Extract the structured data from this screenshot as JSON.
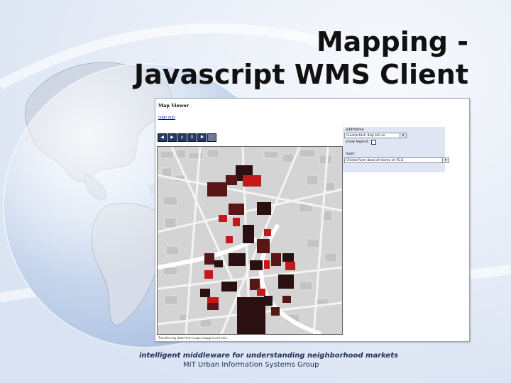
{
  "slide": {
    "title_line1": "Mapping -",
    "title_line2": "Javascript WMS Client",
    "footer_line1": "intelligent middleware for understanding neighborhood markets",
    "footer_line2": "MIT Urban Information Systems Group"
  },
  "app": {
    "title": "Map Viewer",
    "top_link": "(sign out)",
    "toolbar": {
      "buttons": [
        {
          "name": "pan-left",
          "glyph": "◀"
        },
        {
          "name": "pan-right",
          "glyph": "▶"
        },
        {
          "name": "home",
          "glyph": "⌂"
        },
        {
          "name": "zoom",
          "glyph": "⚲"
        },
        {
          "name": "settings",
          "glyph": "✱"
        },
        {
          "name": "extra",
          "glyph": "·"
        }
      ]
    },
    "panel": {
      "section1_label": "addtheme",
      "theme_select_value": "muscle fact. disp tch ce",
      "show_legend_label": "show legend:",
      "section2_label": "layer:",
      "layer_select_value": "Chilled form daea of eleme ch fG.S."
    },
    "status_text": "Transferring data from mapx.mapgrid.mit.edu..."
  },
  "colors": {
    "slide_bg": "#e9eff9",
    "panel_bg": "#dfe5f2",
    "block_dark": "#2a1010",
    "block_maroon": "#5a1616",
    "block_red": "#c21a1a"
  }
}
